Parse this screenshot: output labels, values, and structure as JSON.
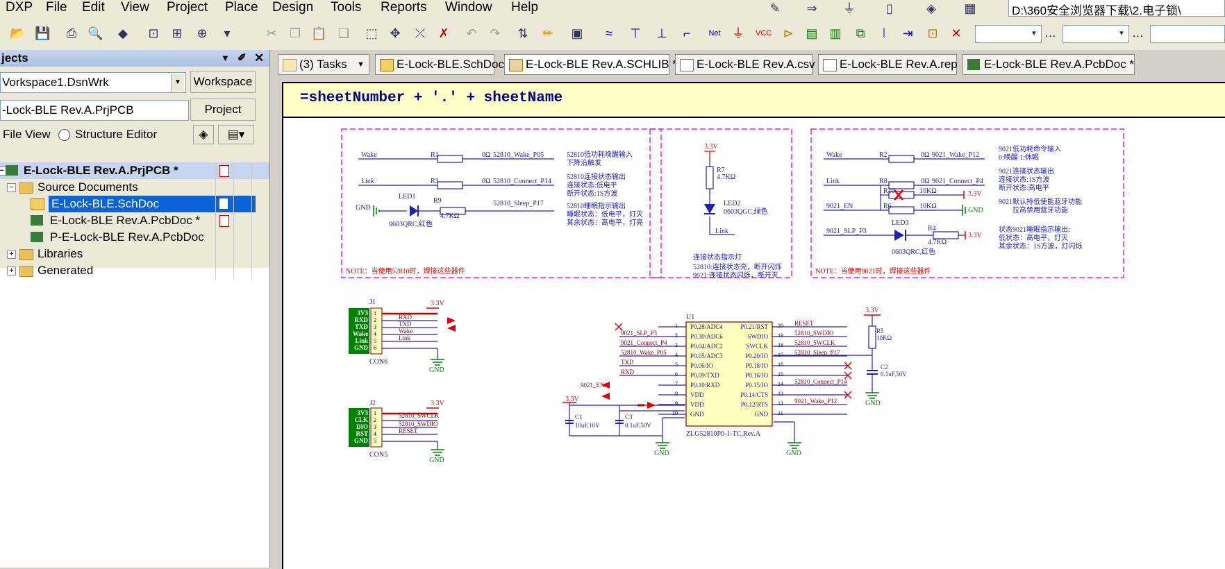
{
  "menu": [
    "DXP",
    "File",
    "Edit",
    "View",
    "Project",
    "Place",
    "Design",
    "Tools",
    "Reports",
    "Window",
    "Help"
  ],
  "path_box": "D:\\360安全浏览器下载\\2.电子锁\\",
  "panel": {
    "title": "jects",
    "workspace_value": "Vorkspace1.DsnWrk",
    "workspace_button": "Workspace",
    "project_value": "-Lock-BLE Rev.A.PrjPCB",
    "project_button": "Project",
    "file_view": "File View",
    "structure_editor": "Structure Editor",
    "tree": {
      "project": "E-Lock-BLE Rev.A.PrjPCB *",
      "source_documents": "Source Documents",
      "doc1": "E-Lock-BLE.SchDoc",
      "doc2": "E-Lock-BLE Rev.A.PcbDoc *",
      "doc3": "P-E-Lock-BLE Rev.A.PcbDoc",
      "libraries": "Libraries",
      "generated": "Generated"
    }
  },
  "tabs": [
    "(3) Tasks",
    "E-Lock-BLE.SchDoc",
    "E-Lock-BLE Rev.A.SCHLIB *",
    "E-Lock-BLE Rev.A.csv",
    "E-Lock-BLE Rev.A.rep",
    "E-Lock-BLE Rev.A.PcbDoc *"
  ],
  "sheet_title": "=sheetNumber +  '.'  + sheetName",
  "schematic": {
    "b1": {
      "wake": "Wake",
      "r1": "R1",
      "r1v": "0Ω",
      "net1": "52810_Wake_P05",
      "d1a": "52810低功耗唤醒输入",
      "d1b": "下降沿触发",
      "link": "Link",
      "r3": "R3",
      "r3v": "0Ω",
      "net2": "52810_Connect_P14",
      "d2a": "52810连接状态输出",
      "d2b": "连接状态:低电平",
      "d2c": "断开状态:1S方波",
      "gnd": "GND",
      "led1": "LED1",
      "r9": "R9",
      "r9v": "4.7KΩ",
      "net3": "52810_Sleep_P17",
      "d3a": "52810睡眠指示输出",
      "d3b": "睡眠状态：低电平，灯灭",
      "d3c": "其余状态：高电平，灯亮",
      "led1v": "0603QRC,红色",
      "note": "NOTE：当使用52810时，焊接这些器件"
    },
    "b2": {
      "v33": "3.3V",
      "r7": "R7",
      "r7v": "4.7KΩ",
      "led2": "LED2",
      "led2v": "0603QGC,绿色",
      "link": "Link",
      "t1": "连接状态指示灯",
      "t2": "52810:连接状态亮，断开闪烁",
      "t3": "9021:连接状态闪烁，断开灭"
    },
    "b3": {
      "wake": "Wake",
      "r2": "R2",
      "r2v": "0Ω",
      "net1": "9021_Wake_P12",
      "d1a": "9021低功耗命令输入",
      "d1b": "0:唤醒  1:休眠",
      "link": "Link",
      "r8": "R8",
      "r8v": "0Ω",
      "net2": "9021_Connect_P4",
      "d2a": "9021连接状态输出",
      "d2b": "连接状态:1S方波",
      "d2c": "断开状态:高电平",
      "r10": "R10",
      "r10v": "10KΩ",
      "v33a": "3.3V",
      "en": "9021_EN",
      "r6": "R6",
      "r6v": "10KΩ",
      "gnd": "GND",
      "d3a": "9021默认持低使能蓝牙功能",
      "d3b": "拉高禁用蓝牙功能",
      "slp": "9021_SLP_P3",
      "led3": "LED3",
      "r4": "R4",
      "r4v": "4.7KΩ",
      "v33b": "3.3V",
      "led3v": "0603QRC,红色",
      "d4a": "状态9021睡眠指示输出:",
      "d4b": "低状态：高电平，灯灭",
      "d4c": "其余状态：1S方波，灯闪烁",
      "note": "NOTE：当使用9021时，焊接这些器件"
    },
    "j1": {
      "ref": "J1",
      "pins": [
        "3V3",
        "RXD",
        "TXD",
        "Wake",
        "Link",
        "GND"
      ],
      "nets": [
        "RXD",
        "TXD",
        "Wake",
        "Link"
      ],
      "v33": "3.3V",
      "gnd": "GND",
      "name": "CON6"
    },
    "j2": {
      "ref": "J2",
      "pins": [
        "3V3",
        "CLK",
        "DIO",
        "RST",
        "GND"
      ],
      "nets": [
        "52810_SWCLK",
        "52810_SWDIO",
        "RESET"
      ],
      "v33": "3.3V",
      "gnd": "GND",
      "name": "CON5"
    },
    "u1": {
      "ref": "U1",
      "part": "ZLG52810P0-1-TC,Rev.A",
      "left_pins": [
        "P0.28/ADC4",
        "P0.30/ADC6",
        "P0.04/ADC2",
        "P0.05/ADC3",
        "P0.06/IO",
        "P0.09/TXD",
        "P0.10/RXD",
        "VDD",
        "VDD",
        "GND"
      ],
      "left_nums": [
        "1",
        "2",
        "3",
        "4",
        "5",
        "6",
        "7",
        "8",
        "9",
        "10"
      ],
      "right_pins": [
        "P0.21/RST",
        "SWDIO",
        "SWCLK",
        "P0.20/IO",
        "P0.18/IO",
        "P0.16/IO",
        "P0.15/IO",
        "P0.14/CTS",
        "P0.12/RTS",
        "GND"
      ],
      "right_nums": [
        "20",
        "19",
        "18",
        "17",
        "16",
        "15",
        "14",
        "13",
        "12",
        "11"
      ],
      "left_nets": [
        "",
        "9021_SLP_P3",
        "9021_Connect_P4",
        "52810_Wake_P05",
        "TXD",
        "RXD"
      ],
      "right_nets": [
        "RESET",
        "52810_SWDIO",
        "52810_SWCLK",
        "52810_Sleep_P17",
        "",
        "",
        "52810_Connect_P14",
        "",
        "9021_Wake_P12"
      ],
      "en": "9021_EN",
      "v33": "3.3V",
      "c1": "C1",
      "c1v": "10uF,10V",
      "c3": "C3",
      "c3v": "0.1uF,50V",
      "gnd1": "GND",
      "gnd2": "GND"
    },
    "rc": {
      "v33": "3.3V",
      "r5": "R5",
      "r5v": "10KΩ",
      "c2": "C2",
      "c2v": "0.1uF,50V",
      "gnd": "GND"
    }
  }
}
